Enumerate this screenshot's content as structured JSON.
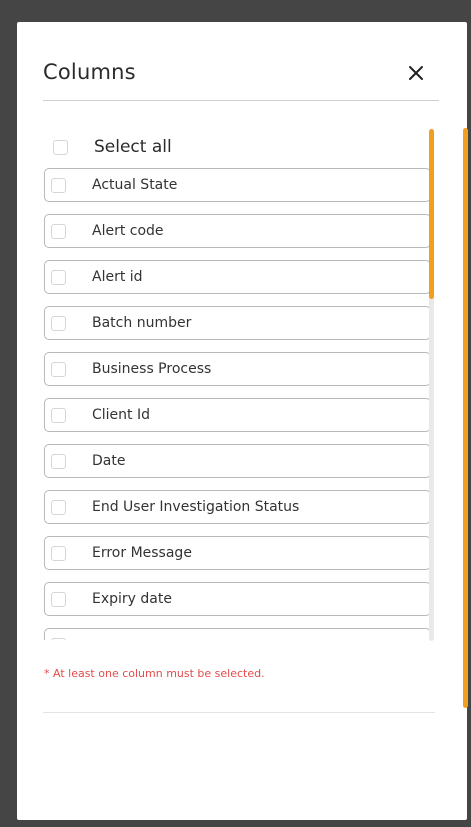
{
  "dialog": {
    "title": "Columns",
    "close_icon": "close-icon",
    "select_all_label": "Select all",
    "columns": [
      {
        "label": "Actual State",
        "checked": false
      },
      {
        "label": "Alert code",
        "checked": false
      },
      {
        "label": "Alert id",
        "checked": false
      },
      {
        "label": "Batch number",
        "checked": false
      },
      {
        "label": "Business Process",
        "checked": false
      },
      {
        "label": "Client Id",
        "checked": false
      },
      {
        "label": "Date",
        "checked": false
      },
      {
        "label": "End User Investigation Status",
        "checked": false
      },
      {
        "label": "Error Message",
        "checked": false
      },
      {
        "label": "Expiry date",
        "checked": false
      },
      {
        "label": "",
        "checked": false
      }
    ],
    "warning": "* At least one column must be selected.",
    "accent_color": "#f0a01e",
    "warning_color": "#e34b4b"
  }
}
